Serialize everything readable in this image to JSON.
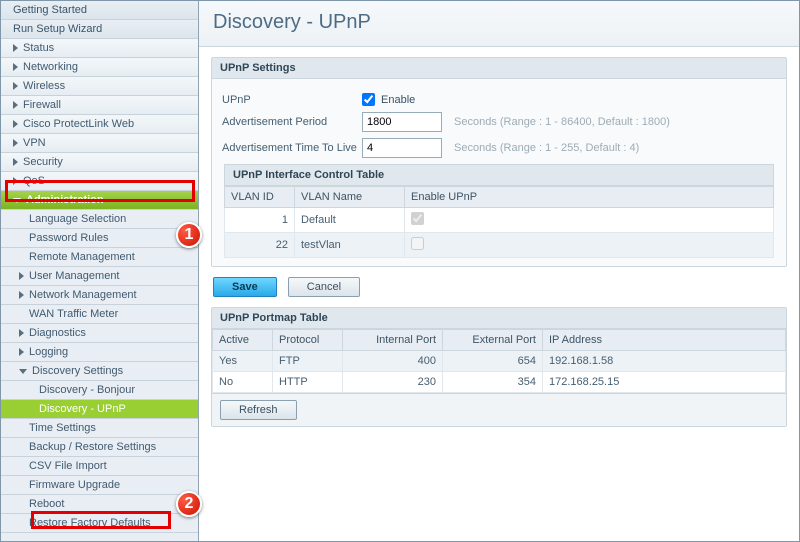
{
  "sidebar": {
    "top": [
      "Getting Started",
      "Run Setup Wizard"
    ],
    "groups": [
      {
        "label": "Status"
      },
      {
        "label": "Networking"
      },
      {
        "label": "Wireless"
      },
      {
        "label": "Firewall"
      },
      {
        "label": "Cisco ProtectLink Web"
      },
      {
        "label": "VPN"
      },
      {
        "label": "Security"
      },
      {
        "label": "QoS"
      }
    ],
    "admin_label": "Administration",
    "admin_items": [
      {
        "label": "Language Selection",
        "indent": 26
      },
      {
        "label": "Password Rules",
        "indent": 26
      },
      {
        "label": "Remote Management",
        "indent": 26
      },
      {
        "label": "User Management",
        "indent": 16,
        "arrow": "right"
      },
      {
        "label": "Network Management",
        "indent": 16,
        "arrow": "right"
      },
      {
        "label": "WAN Traffic Meter",
        "indent": 26
      },
      {
        "label": "Diagnostics",
        "indent": 16,
        "arrow": "right"
      },
      {
        "label": "Logging",
        "indent": 16,
        "arrow": "right"
      },
      {
        "label": "Discovery Settings",
        "indent": 16,
        "arrow": "down"
      },
      {
        "label": "Discovery - Bonjour",
        "indent": 36
      },
      {
        "label": "Discovery - UPnP",
        "indent": 36,
        "active": true
      },
      {
        "label": "Time Settings",
        "indent": 26
      },
      {
        "label": "Backup / Restore Settings",
        "indent": 26
      },
      {
        "label": "CSV File Import",
        "indent": 26
      },
      {
        "label": "Firmware Upgrade",
        "indent": 26
      },
      {
        "label": "Reboot",
        "indent": 26
      },
      {
        "label": "Restore Factory Defaults",
        "indent": 26
      }
    ]
  },
  "page": {
    "title": "Discovery - UPnP"
  },
  "settings": {
    "heading": "UPnP Settings",
    "upnp_label": "UPnP",
    "enable_label": "Enable",
    "upnp_enabled": true,
    "adv_period_label": "Advertisement Period",
    "adv_period": "1800",
    "adv_period_hint": "Seconds (Range : 1 - 86400, Default : 1800)",
    "adv_ttl_label": "Advertisement Time To Live",
    "adv_ttl": "4",
    "adv_ttl_hint": "Seconds (Range : 1 - 255, Default : 4)"
  },
  "iface_table": {
    "heading": "UPnP Interface Control Table",
    "cols": {
      "vlan_id": "VLAN ID",
      "vlan_name": "VLAN Name",
      "enable": "Enable UPnP"
    },
    "rows": [
      {
        "id": "1",
        "name": "Default",
        "enabled": true
      },
      {
        "id": "22",
        "name": "testVlan",
        "enabled": false
      }
    ]
  },
  "buttons": {
    "save": "Save",
    "cancel": "Cancel",
    "refresh": "Refresh"
  },
  "portmap": {
    "heading": "UPnP Portmap Table",
    "cols": {
      "active": "Active",
      "protocol": "Protocol",
      "iport": "Internal Port",
      "eport": "External Port",
      "ip": "IP Address"
    },
    "rows": [
      {
        "active": "Yes",
        "protocol": "FTP",
        "iport": "400",
        "eport": "654",
        "ip": "192.168.1.58"
      },
      {
        "active": "No",
        "protocol": "HTTP",
        "iport": "230",
        "eport": "354",
        "ip": "172.168.25.15"
      }
    ]
  },
  "callouts": {
    "c1": "1",
    "c2": "2"
  }
}
